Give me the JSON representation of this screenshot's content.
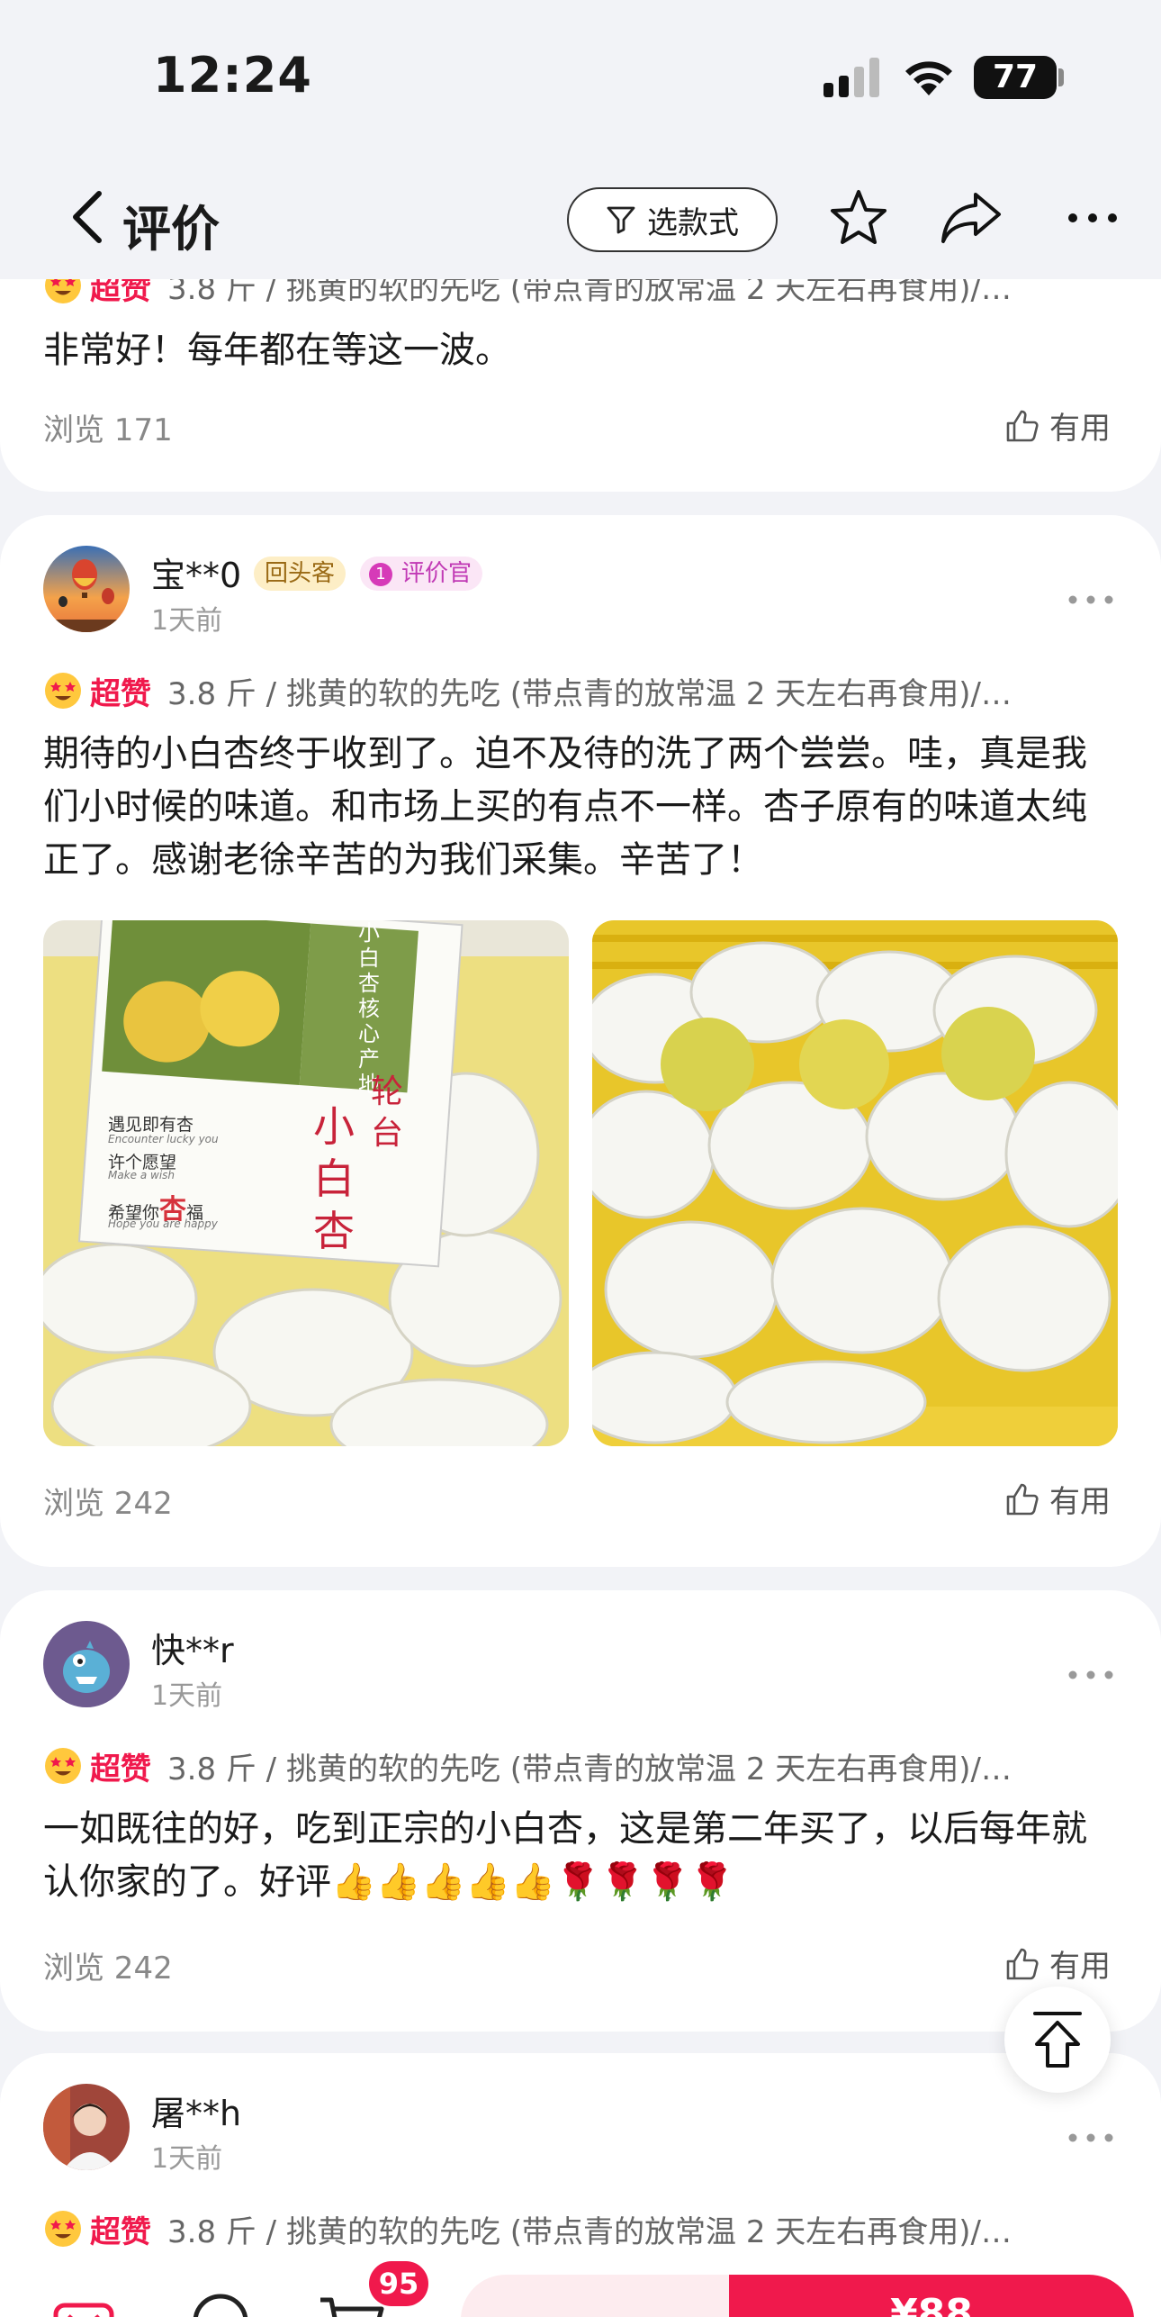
{
  "status_bar": {
    "time": "12:24",
    "battery": "77"
  },
  "header": {
    "title": "评价",
    "filter_label": "选款式"
  },
  "top_partial_review": {
    "super_label": "超赞",
    "spec": "3.8 斤 / 挑黄的软的先吃 (带点青的放常温 2 天左右再食用)/…",
    "text": "非常好！每年都在等这一波。",
    "views": "浏览 171",
    "useful": "有用"
  },
  "reviews": [
    {
      "user": "宝**0",
      "tags": [
        "回头客",
        "评价官"
      ],
      "date": "1天前",
      "super_label": "超赞",
      "spec": "3.8 斤 / 挑黄的软的先吃 (带点青的放常温 2 天左右再食用)/…",
      "text": "期待的小白杏终于收到了。迫不及待的洗了两个尝尝。哇，真是我们小时候的味道。和市场上买的有点不一样。杏子原有的味道太纯正了。感谢老徐辛苦的为我们采集。辛苦了！",
      "photo1": {
        "brand_vertical": "小白杏核心产地",
        "tagline1": "遇见即有杏",
        "tagline1_en": "Encounter lucky you",
        "tagline2": "许个愿望",
        "tagline2_en": "Make a wish",
        "wish_prefix": "希望你",
        "wish_highlight": "杏",
        "wish_suffix": "福",
        "wish_en": "Hope you are happy",
        "title_main": "小白杏",
        "title_side": "轮台"
      },
      "views": "浏览 242",
      "useful": "有用"
    },
    {
      "user": "快**r",
      "date": "1天前",
      "super_label": "超赞",
      "spec": "3.8 斤 / 挑黄的软的先吃 (带点青的放常温 2 天左右再食用)/…",
      "text": "一如既往的好，吃到正宗的小白杏，这是第二年买了，以后每年就认你家的了。好评👍👍👍👍👍🌹🌹🌹🌹",
      "views": "浏览 242",
      "useful": "有用"
    },
    {
      "user": "屠**h",
      "date": "1天前",
      "super_label": "超赞",
      "spec": "3.8 斤 / 挑黄的软的先吃 (带点青的放常温 2 天左右再食用)/…"
    }
  ],
  "bottom_bar": {
    "cart_count": "95",
    "price": "¥88"
  },
  "colors": {
    "accent": "#f0194c",
    "background": "#f2f3f7"
  }
}
